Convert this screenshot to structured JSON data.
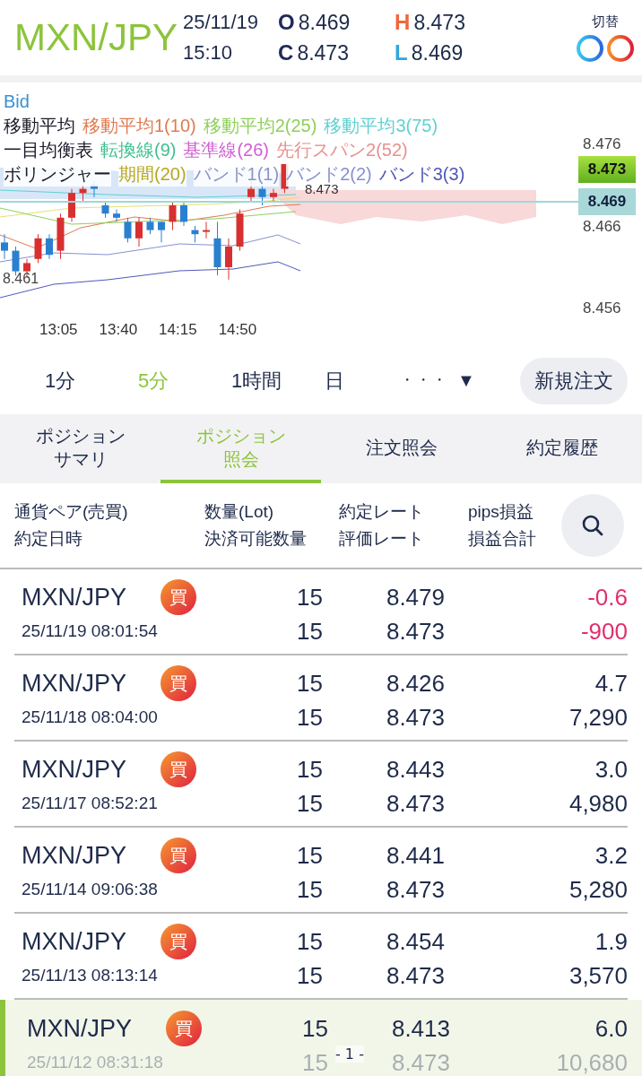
{
  "header": {
    "pair": "MXN/JPY",
    "date": "25/11/19",
    "time": "15:10",
    "quotes": [
      {
        "key": "O",
        "value": "8.469",
        "color": "#1e2a5a"
      },
      {
        "key": "H",
        "value": "8.473",
        "color": "#f0683c"
      },
      {
        "key": "C",
        "value": "8.473",
        "color": "#1e2a5a"
      },
      {
        "key": "L",
        "value": "8.469",
        "color": "#2aa8e0"
      }
    ],
    "switch_label": "切替"
  },
  "chart": {
    "price_type": "Bid",
    "legend": [
      {
        "group": "移動平均",
        "items": [
          {
            "label": "移動平均1(10)",
            "color": "#e07a50"
          },
          {
            "label": "移動平均2(25)",
            "color": "#8ed05a"
          },
          {
            "label": "移動平均3(75)",
            "color": "#5fd0d0"
          }
        ]
      },
      {
        "group": "一目均衡表",
        "items": [
          {
            "label": "転換線(9)",
            "color": "#40c090"
          },
          {
            "label": "基準線(26)",
            "color": "#d060d0"
          },
          {
            "label": "先行スパン2(52)",
            "color": "#e89090"
          }
        ]
      },
      {
        "group": "ボリンジャー",
        "items": [
          {
            "label": "期間(20)",
            "color": "#b8a820"
          },
          {
            "label": "バンド1(1)",
            "color": "#8c94c8"
          },
          {
            "label": "バンド2(2)",
            "color": "#8890d0"
          },
          {
            "label": "バンド3(3)",
            "color": "#5058b8"
          }
        ]
      }
    ],
    "high_label": "8.473",
    "low_label": "8.461",
    "y_labels": [
      "8.476",
      "8.466",
      "8.456"
    ],
    "last_price": "8.473",
    "bid_price": "8.469",
    "x_labels": [
      "13:05",
      "13:40",
      "14:15",
      "14:50"
    ]
  },
  "timeframes": [
    {
      "label": "1分",
      "selected": false
    },
    {
      "label": "5分",
      "selected": true
    },
    {
      "label": "1時間",
      "selected": false
    },
    {
      "label": "日",
      "selected": false
    }
  ],
  "more": "・・・",
  "dropdown": "▼",
  "new_order": "新規注文",
  "tabs": [
    {
      "label": "ポジションサマリ",
      "selected": false
    },
    {
      "label": "ポジション照会",
      "selected": true
    },
    {
      "label": "注文照会",
      "selected": false
    },
    {
      "label": "約定履歴",
      "selected": false
    }
  ],
  "columns": [
    [
      "通貨ペア(売買)",
      "約定日時"
    ],
    [
      "数量(Lot)",
      "決済可能数量"
    ],
    [
      "約定レート",
      "評価レート"
    ],
    [
      "pips損益",
      "損益合計"
    ]
  ],
  "rows": [
    {
      "pair": "MXN/JPY",
      "side": "買",
      "datetime": "25/11/19 08:01:54",
      "qty": "15",
      "closable": "15",
      "rate": "8.479",
      "eval_rate": "8.473",
      "pips": "-0.6",
      "pnl": "-900",
      "negative": true,
      "selected": false
    },
    {
      "pair": "MXN/JPY",
      "side": "買",
      "datetime": "25/11/18 08:04:00",
      "qty": "15",
      "closable": "15",
      "rate": "8.426",
      "eval_rate": "8.473",
      "pips": "4.7",
      "pnl": "7,290",
      "negative": false,
      "selected": false
    },
    {
      "pair": "MXN/JPY",
      "side": "買",
      "datetime": "25/11/17 08:52:21",
      "qty": "15",
      "closable": "15",
      "rate": "8.443",
      "eval_rate": "8.473",
      "pips": "3.0",
      "pnl": "4,980",
      "negative": false,
      "selected": false
    },
    {
      "pair": "MXN/JPY",
      "side": "買",
      "datetime": "25/11/14 09:06:38",
      "qty": "15",
      "closable": "15",
      "rate": "8.441",
      "eval_rate": "8.473",
      "pips": "3.2",
      "pnl": "5,280",
      "negative": false,
      "selected": false
    },
    {
      "pair": "MXN/JPY",
      "side": "買",
      "datetime": "25/11/13 08:13:14",
      "qty": "15",
      "closable": "15",
      "rate": "8.454",
      "eval_rate": "8.473",
      "pips": "1.9",
      "pnl": "3,570",
      "negative": false,
      "selected": false
    },
    {
      "pair": "MXN/JPY",
      "side": "買",
      "datetime": "25/11/12 08:31:18",
      "qty": "15",
      "closable": "15",
      "rate": "8.413",
      "eval_rate": "8.473",
      "pips": "6.0",
      "pnl": "10,680",
      "negative": false,
      "selected": true
    }
  ],
  "page_indicator": "- 1 -"
}
